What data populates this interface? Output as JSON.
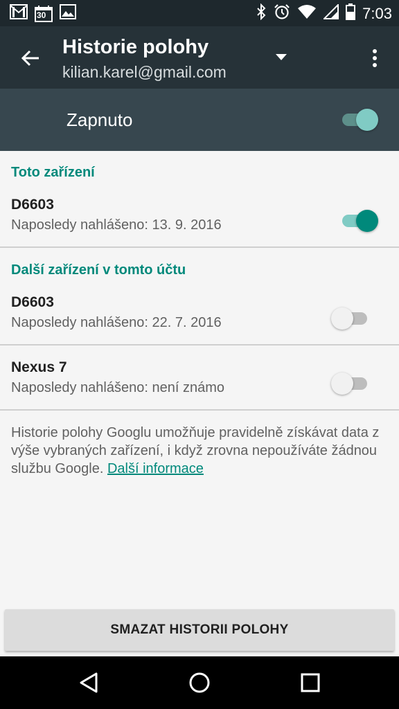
{
  "status_bar": {
    "time": "7:03",
    "calendar_day": "30",
    "left_icons": [
      "gmail-icon",
      "calendar-icon",
      "gallery-icon"
    ],
    "right_icons": [
      "bluetooth-icon",
      "alarm-icon",
      "wifi-icon",
      "signal-icon",
      "battery-icon"
    ]
  },
  "app_bar": {
    "title": "Historie polohy",
    "account": "kilian.karel@gmail.com"
  },
  "master_switch": {
    "label": "Zapnuto",
    "on": true
  },
  "this_device": {
    "header": "Toto zařízení",
    "name": "D6603",
    "last_reported": "Naposledy nahlášeno: 13. 9. 2016",
    "on": true
  },
  "other_devices": {
    "header": "Další zařízení v tomto účtu",
    "items": [
      {
        "name": "D6603",
        "last_reported": "Naposledy nahlášeno: 22. 7. 2016",
        "on": false
      },
      {
        "name": "Nexus 7",
        "last_reported": "Naposledy nahlášeno: není známo",
        "on": false
      }
    ]
  },
  "info": {
    "text": "Historie polohy Googlu umožňuje pravidelně získávat data z výše vybraných zařízení, i když zrovna nepoužíváte žádnou službu Google. ",
    "link": "Další informace"
  },
  "delete_button": "SMAZAT HISTORII POLOHY",
  "colors": {
    "accent": "#00897b",
    "app_bar": "#263238",
    "master_bar": "#37474f"
  }
}
